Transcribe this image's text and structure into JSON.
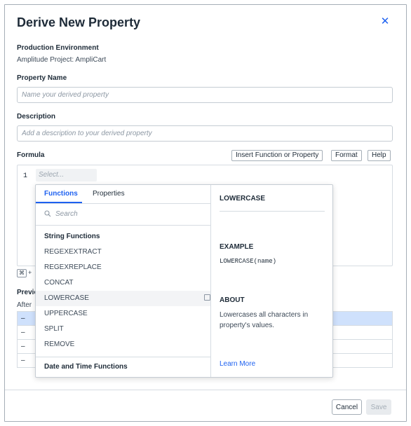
{
  "modal": {
    "title": "Derive New Property",
    "close_icon": "close-icon"
  },
  "environment": {
    "label": "Production Environment",
    "value": "Amplitude Project: AmpliCart"
  },
  "property_name": {
    "label": "Property Name",
    "placeholder": "Name your derived property"
  },
  "description": {
    "label": "Description",
    "placeholder": "Add a description to your derived property"
  },
  "formula": {
    "label": "Formula",
    "buttons": {
      "insert": "Insert Function or Property",
      "format": "Format",
      "help": "Help"
    },
    "line_number": "1",
    "select_placeholder": "Select...",
    "shortcut_key": "⌘",
    "shortcut_plus": "+"
  },
  "preview": {
    "label": "Previe",
    "after_label": "After",
    "rows": [
      "–",
      "–",
      "–",
      "–"
    ]
  },
  "dropdown": {
    "tabs": [
      "Functions",
      "Properties"
    ],
    "search_placeholder": "Search",
    "groups": [
      {
        "name": "String Functions",
        "items": [
          "REGEXEXTRACT",
          "REGEXREPLACE",
          "CONCAT",
          "LOWERCASE",
          "UPPERCASE",
          "SPLIT",
          "REMOVE"
        ]
      },
      {
        "name": "Date and Time Functions",
        "items": []
      }
    ],
    "hovered_item": "LOWERCASE",
    "detail": {
      "title": "LOWERCASE",
      "example_heading": "EXAMPLE",
      "example_value": "LOWERCASE(name)",
      "about_heading": "ABOUT",
      "about_text": "Lowercases all characters in property's values.",
      "learn_more": "Learn More"
    }
  },
  "footer": {
    "cancel": "Cancel",
    "save": "Save"
  },
  "colors": {
    "accent": "#1e61f0",
    "selected_row": "#cfe1fc"
  }
}
